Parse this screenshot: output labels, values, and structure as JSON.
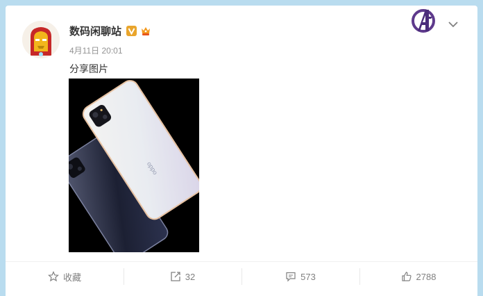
{
  "post": {
    "author": "数码闲聊站",
    "timestamp": "4月11日 20:01",
    "text": "分享图片"
  },
  "actions": {
    "favorite_label": "收藏",
    "repost_count": "32",
    "comment_count": "573",
    "like_count": "2788"
  },
  "colors": {
    "page_background": "#b9dcef",
    "card": "#ffffff",
    "verified_badge": "#e9a52c",
    "muted_text": "#808080"
  },
  "icons": [
    "iron-man-avatar",
    "verified-badge-icon",
    "member-badge-icon",
    "avengers-logo-icon",
    "chevron-down-icon",
    "star-icon",
    "share-icon",
    "comment-icon",
    "thumbs-up-icon"
  ]
}
